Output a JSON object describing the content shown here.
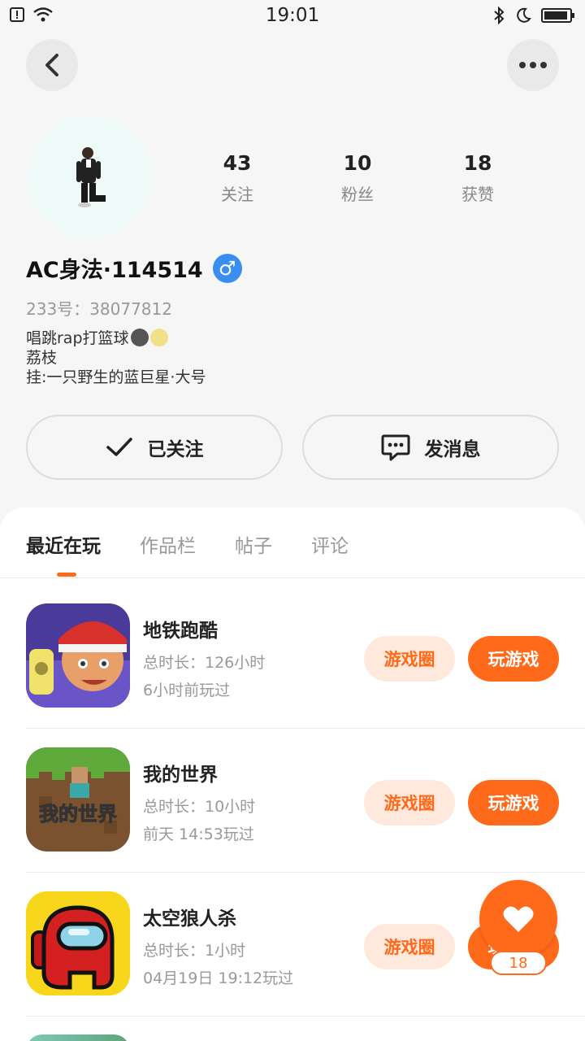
{
  "status_bar": {
    "time": "19:01"
  },
  "profile": {
    "stats": [
      {
        "num": "43",
        "label": "关注"
      },
      {
        "num": "10",
        "label": "粉丝"
      },
      {
        "num": "18",
        "label": "获赞"
      }
    ],
    "username": "AC身法·114514",
    "gender_symbol": "♂",
    "uid": "233号：38077812",
    "bio": [
      "唱跳rap打篮球",
      "荔枝",
      "挂:一只野生的蓝巨星·大号"
    ]
  },
  "actions": {
    "follow_label": "已关注",
    "message_label": "发消息"
  },
  "tabs": [
    {
      "label": "最近在玩",
      "active": true
    },
    {
      "label": "作品栏",
      "active": false
    },
    {
      "label": "帖子",
      "active": false
    },
    {
      "label": "评论",
      "active": false
    }
  ],
  "games": [
    {
      "name": "地铁跑酷",
      "duration": "总时长：126小时",
      "last_played": "6小时前玩过",
      "circle_label": "游戏圈",
      "play_label": "玩游戏"
    },
    {
      "name": "我的世界",
      "duration": "总时长：10小时",
      "last_played": "前天 14:53玩过",
      "circle_label": "游戏圈",
      "play_label": "玩游戏",
      "icon_text": "我的世界"
    },
    {
      "name": "太空狼人杀",
      "duration": "总时长：1小时",
      "last_played": "04月19日 19:12玩过",
      "circle_label": "游戏圈",
      "play_label": "玩游戏"
    }
  ],
  "like": {
    "count": "18"
  },
  "colors": {
    "accent": "#ff6a1a",
    "accent_light": "#ffe9dc",
    "gender_blue": "#3a8ef0"
  }
}
